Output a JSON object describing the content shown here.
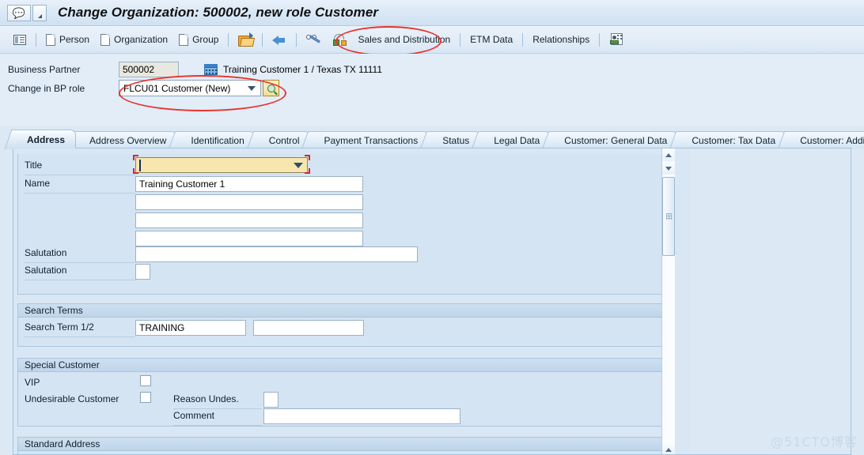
{
  "window": {
    "title": "Change Organization: 500002, new role Customer",
    "system_icon": "sap-window-icon",
    "menu_caret": "menu-caret-icon"
  },
  "toolbar": {
    "items": [
      {
        "id": "list",
        "icon": "list-icon",
        "label": ""
      },
      {
        "id": "person",
        "icon": "document-icon",
        "label": "Person"
      },
      {
        "id": "organization",
        "icon": "document-icon",
        "label": "Organization"
      },
      {
        "id": "group",
        "icon": "document-icon",
        "label": "Group"
      },
      {
        "id": "open",
        "icon": "open-folder-icon",
        "label": ""
      },
      {
        "id": "back",
        "icon": "back-arrow-icon",
        "label": ""
      },
      {
        "id": "display-change",
        "icon": "glasses-pencil-icon",
        "label": ""
      },
      {
        "id": "authorization",
        "icon": "lock-icon",
        "label": ""
      },
      {
        "id": "sales-and-distribution",
        "icon": "",
        "label": "Sales and Distribution"
      },
      {
        "id": "etm-data",
        "icon": "",
        "label": "ETM Data"
      },
      {
        "id": "relationships",
        "icon": "",
        "label": "Relationships"
      },
      {
        "id": "person-card",
        "icon": "person-card-icon",
        "label": ""
      }
    ]
  },
  "header": {
    "business_partner_label": "Business Partner",
    "business_partner_value": "500002",
    "partner_icon": "building-icon",
    "partner_description": "Training Customer 1 / Texas TX 11111",
    "bp_role_label": "Change in BP role",
    "bp_role_value": "FLCU01 Customer (New)",
    "bp_role_search_icon": "search-help-icon"
  },
  "tabs": [
    {
      "label": "Address",
      "active": true
    },
    {
      "label": "Address Overview",
      "active": false
    },
    {
      "label": "Identification",
      "active": false
    },
    {
      "label": "Control",
      "active": false
    },
    {
      "label": "Payment Transactions",
      "active": false
    },
    {
      "label": "Status",
      "active": false
    },
    {
      "label": "Legal Data",
      "active": false
    },
    {
      "label": "Customer: General Data",
      "active": false
    },
    {
      "label": "Customer: Tax Data",
      "active": false
    },
    {
      "label": "Customer: Additio",
      "active": false
    }
  ],
  "form": {
    "name_group": {
      "fields": {
        "title_label": "Title",
        "title_value": "",
        "name_label": "Name",
        "name_value_1": "Training Customer 1",
        "name_value_2": "",
        "name_value_3": "",
        "name_value_4": "",
        "salutation_label_1": "Salutation",
        "salutation_value_1": "",
        "salutation_label_2": "Salutation",
        "salutation_value_2": ""
      }
    },
    "search_terms_group": {
      "title": "Search Terms",
      "search_term_label": "Search Term 1/2",
      "search_term_1": "TRAINING",
      "search_term_2": ""
    },
    "special_customer_group": {
      "title": "Special Customer",
      "vip_label": "VIP",
      "vip_checked": false,
      "undesirable_label": "Undesirable Customer",
      "undesirable_checked": false,
      "reason_label": "Reason Undes.",
      "reason_value": "",
      "comment_label": "Comment",
      "comment_value": ""
    },
    "standard_address_group": {
      "title": "Standard Address"
    }
  },
  "scrollbar": {
    "up_icon": "scroll-up-icon",
    "down_icon": "scroll-down-icon",
    "grip_icon": "scroll-grip-icon"
  },
  "watermark": "@51CTO博客",
  "colors": {
    "accent_blue": "#d9e7f5",
    "highlight_red": "#e8342c",
    "focus_yellow": "#f7e7ae",
    "required_corner": "#d2272e"
  }
}
